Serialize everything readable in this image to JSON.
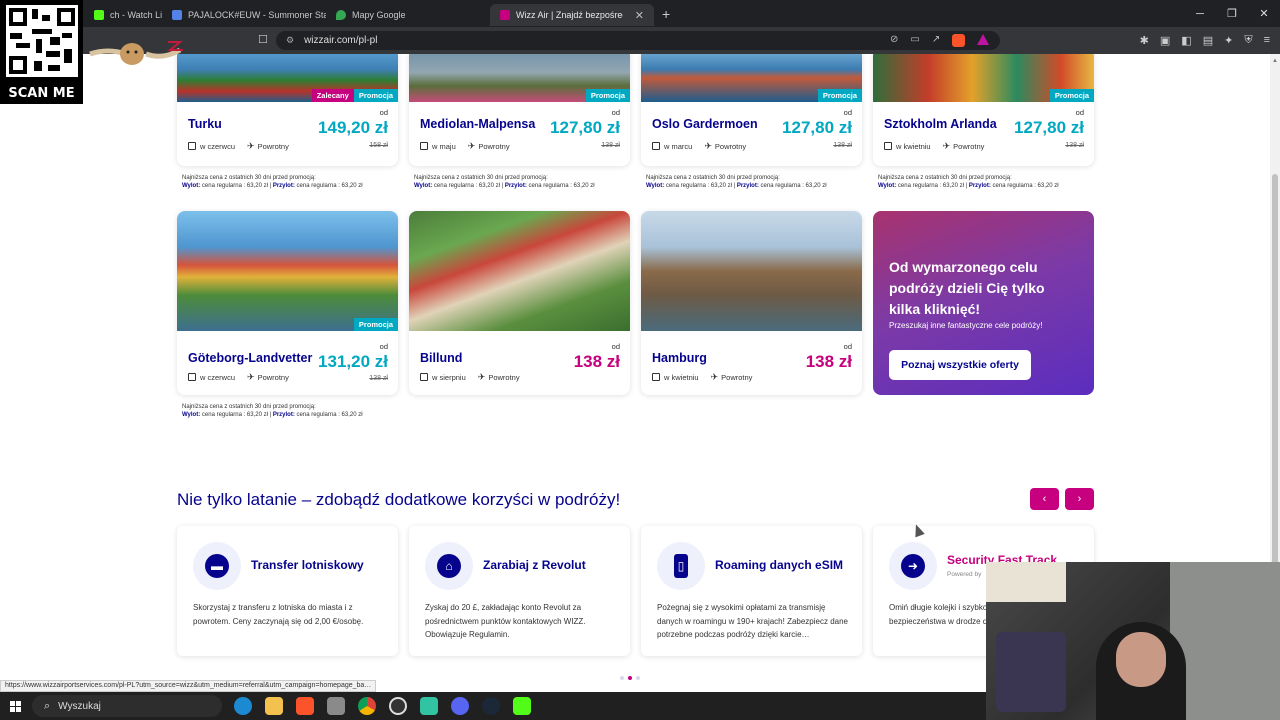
{
  "browser": {
    "tabs": [
      {
        "title": "ch - Watch Live on Ki",
        "fav_color": "#53fc18"
      },
      {
        "title": "PAJALOCK#EUW - Summoner Stats",
        "fav_color": "#5383e8"
      },
      {
        "title": "Mapy Google",
        "fav_color": "#34a853"
      },
      {
        "title": "Wizz Air | Znajdź bezpośrednio",
        "fav_color": "#c6007e",
        "active": true
      }
    ],
    "new_tab": "+",
    "url": "wizzair.com/pl-pl"
  },
  "overlay": {
    "scan_me": "SCAN ME"
  },
  "destinations_row1": [
    {
      "city": "Turku",
      "when": "w czerwcu",
      "trip": "Powrotny",
      "od": "od",
      "price": "149,20 zł",
      "old_price": "158 zł",
      "badges": [
        "Zalecany",
        "Promocja"
      ],
      "price_color": "teal"
    },
    {
      "city": "Mediolan-Malpensa",
      "when": "w maju",
      "trip": "Powrotny",
      "od": "od",
      "price": "127,80 zł",
      "old_price": "138 zł",
      "badges": [
        "Promocja"
      ],
      "price_color": "teal"
    },
    {
      "city": "Oslo Gardermoen",
      "when": "w marcu",
      "trip": "Powrotny",
      "od": "od",
      "price": "127,80 zł",
      "old_price": "138 zł",
      "badges": [
        "Promocja"
      ],
      "price_color": "teal"
    },
    {
      "city": "Sztokholm Arlanda",
      "when": "w kwietniu",
      "trip": "Powrotny",
      "od": "od",
      "price": "127,80 zł",
      "old_price": "138 zł",
      "badges": [
        "Promocja"
      ],
      "price_color": "teal"
    }
  ],
  "destinations_row2": [
    {
      "city": "Göteborg-Landvetter",
      "when": "w czerwcu",
      "trip": "Powrotny",
      "od": "od",
      "price": "131,20 zł",
      "old_price": "138 zł",
      "badges": [
        "Promocja"
      ],
      "price_color": "teal"
    },
    {
      "city": "Billund",
      "when": "w sierpniu",
      "trip": "Powrotny",
      "od": "od",
      "price": "138 zł",
      "old_price": "",
      "badges": [],
      "price_color": "mag"
    },
    {
      "city": "Hamburg",
      "when": "w kwietniu",
      "trip": "Powrotny",
      "od": "od",
      "price": "138 zł",
      "old_price": "",
      "badges": [],
      "price_color": "mag"
    }
  ],
  "price_note": {
    "line1": "Najniższa cena z ostatnich 30 dni przed promocją:",
    "wylot_label": "Wylot:",
    "wylot_text": " cena regularna : 63,20 zł | ",
    "przylot_label": "Przylot:",
    "przylot_text": " cena regularna : 63,20 zł"
  },
  "promo": {
    "title": "Od wymarzonego celu podróży dzieli Cię tylko kilka kliknięć!",
    "subtitle": "Przeszukaj inne fantastyczne cele podróży!",
    "button": "Poznaj wszystkie oferty"
  },
  "benefits_section": {
    "title": "Nie tylko latanie – zdobądź dodatkowe korzyści w podróży!",
    "prev": "‹",
    "next": "›",
    "items": [
      {
        "title": "Transfer lotniskowy",
        "desc": "Skorzystaj z transferu z lotniska do miasta i z powrotem. Ceny zaczynają się od 2,00 €/osobę.",
        "icon": "🚌"
      },
      {
        "title": "Zarabiaj z Revolut",
        "desc": "Zyskaj do 20 £, zakładając konto Revolut za pośrednictwem punktów kontaktowych WIZZ. Obowiązuje Regulamin.",
        "icon": "🏛"
      },
      {
        "title": "Roaming danych eSIM",
        "desc": "Pożegnaj się z wysokimi opłatami za transmisję danych w roamingu w 190+ krajach! Zabezpiecz dane potrzebne podczas podróży dzięki karcie…",
        "icon": "▯"
      },
      {
        "title": "Security Fast Track",
        "powered": "Powered by",
        "desc": "Omiń długie kolejki i szybko przejdź przez kontrolę bezpieczeństwa w drodze do szczytu.",
        "icon": "🏃"
      }
    ]
  },
  "status_url": "https://www.wizzairportservices.com/pl-PL?utm_source=wizz&utm_medium=referral&utm_campaign=homepage_ba…",
  "taskbar": {
    "search": "Wyszukaj"
  },
  "colors": {
    "navy": "#06038d",
    "magenta": "#c6007e",
    "teal": "#00a9c1"
  }
}
